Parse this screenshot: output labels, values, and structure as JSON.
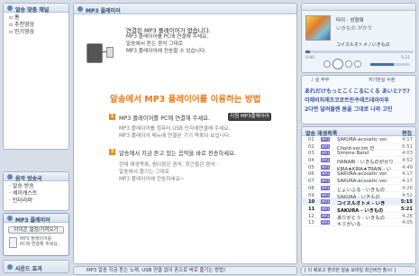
{
  "left": {
    "sections": [
      {
        "title": "알송 맞춤 채널",
        "items": [
          "홈",
          "추천영상",
          "인기영상"
        ]
      },
      {
        "title": "음악 방송국",
        "items": [
          "· 알송 방송",
          "· 세이캐스트",
          "· 인터라퍼"
        ]
      },
      {
        "title": "MP3 플레이어",
        "buttons": [
          "아이콘 설정/가져오기"
        ],
        "device_text": [
          "MP3 플레이어를",
          "PC에 연결해 주세요."
        ]
      },
      {
        "title": "사운드 효과"
      }
    ]
  },
  "center": {
    "title": "MP3 플레이어",
    "notice_title": "연결된 MP3 플레이어가 없습니다.",
    "notice_lines": [
      "MP3 플레이어를 PC에 연결해 주세요.",
      "알송에서 듣는 음악 그대로",
      "MP3 플레이어에 전송할 수 있습니다."
    ],
    "guide_title": "알송에서 MP3 플레이어를 이용하는 방법",
    "step1": {
      "num": "1",
      "text": "MP3 플레이어를 PC에 연결해 주세요.",
      "button": "지원 MP3플레이어",
      "desc": [
        "MP3 플레이어를 컴퓨터 USB 단자에연결해 주세요.",
        "MP3 플레이어 메뉴에 연결된 기기 목록이 보입니다."
      ]
    },
    "step2": {
      "num": "2",
      "text": "알송에서 지금 듣고 있는 음악을 바로 전송하세요.",
      "desc": [
        "현재 재생목록, 찜이음은 음악, 최근들은 음악 ·",
        "알송에서 즐기는 그대로",
        "MP3 플레이어에 전송하세요~"
      ]
    }
  },
  "status_bar": {
    "left": "MP3 알송 지금 듣는 노래, USB 연결 없이 폰으로 바로 즐기는 방법!",
    "right": "[ 이 배포고 편리한 알송 모바일 최신버전 출시! ]"
  },
  "player": {
    "title": "타이 · 성형돼",
    "subtitle": "いきもの がかり",
    "lyrics_line": "コイスルオトメ / いきもの",
    "times": [
      "0:00",
      "5:21"
    ],
    "lyrics": [
      "あれだけもっとこくこるにくる あいと?で?",
      "이래비처래조코로트린쿠래즈데라아투",
      "2다면 달려볼렌 몸을 그대로 나와 고민"
    ],
    "lyrics_tabs": [
      "♪ 실 주부",
      "자기만실 수정"
    ],
    "playlist_label": "알송 재생목록",
    "playlist_buttons": [
      "편집"
    ],
    "tracks": [
      {
        "n": "01",
        "title": "SAKURA-acoustic ver.",
        "dur": "4:17"
      },
      {
        "n": "02",
        "title": "Chord-ver.tm 전",
        "dur": "5:51"
      },
      {
        "n": "03",
        "title": "Simone Batel",
        "dur": "4:03"
      },
      {
        "n": "04",
        "title": "HANABI - いきものがかり",
        "dur": "4:52"
      },
      {
        "n": "05",
        "title": "KIRA★KIRA★TRAIN - い",
        "dur": "4:49"
      },
      {
        "n": "06",
        "title": "SAKURA-acoustic ver.",
        "dur": "4:17"
      },
      {
        "n": "07",
        "title": "SAKURA-acoustic ver.",
        "dur": "4:17"
      },
      {
        "n": "08",
        "title": "じょいふる - いきもの",
        "dur": "4:26"
      },
      {
        "n": "09",
        "title": "SAKURA - いきもの",
        "dur": "4:52"
      },
      {
        "n": "10",
        "title": "コイスルオトメ - いき",
        "dur": "5:15"
      },
      {
        "n": "11",
        "title": "SAKURA - いきもの",
        "dur": "5:21"
      },
      {
        "n": "12",
        "title": "ありがとう - いきもの",
        "dur": "4:26"
      },
      {
        "n": "13",
        "title": "キミがいる",
        "dur": "4:05"
      }
    ]
  }
}
